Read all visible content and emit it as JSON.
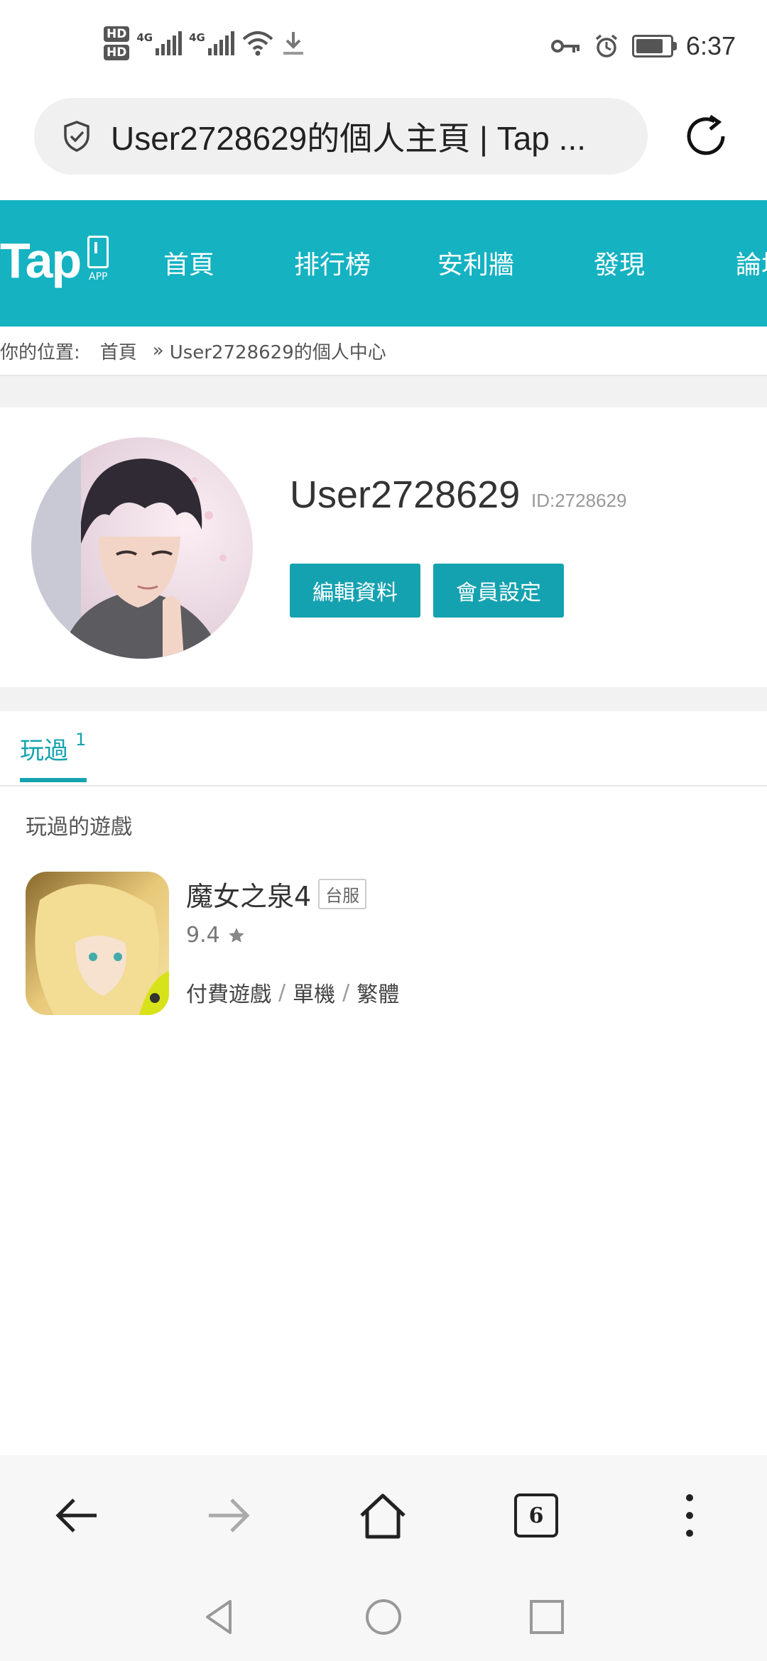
{
  "status_bar": {
    "hd1": "HD",
    "hd2": "HD",
    "net1": "4G",
    "net2": "4G",
    "time": "6:37",
    "battery_level": 0.8
  },
  "url_bar": {
    "title": "User2728629的個人主頁 | Tap ..."
  },
  "site_nav": {
    "logo": "Tap",
    "logo_sub": "APP",
    "items": [
      {
        "label": "首頁"
      },
      {
        "label": "排行榜"
      },
      {
        "label": "安利牆"
      },
      {
        "label": "發現"
      },
      {
        "label": "論壇"
      }
    ]
  },
  "breadcrumb": {
    "prefix": "你的位置:",
    "home": "首頁",
    "separator": "»",
    "current": "User2728629的個人中心"
  },
  "profile": {
    "username": "User2728629",
    "user_id": "ID:2728629",
    "edit_button": "編輯資料",
    "settings_button": "會員設定"
  },
  "tabs": [
    {
      "label": "玩過",
      "count": "1",
      "active": true
    }
  ],
  "played_section": {
    "title": "玩過的遊戲",
    "games": [
      {
        "title": "魔女之泉4",
        "region": "台服",
        "rating": "9.4",
        "tags": [
          "付費遊戲",
          "單機",
          "繁體"
        ]
      }
    ]
  },
  "browser_toolbar": {
    "tab_count": "6"
  },
  "colors": {
    "brand": "#15b2c2",
    "button": "#15a2b0"
  }
}
